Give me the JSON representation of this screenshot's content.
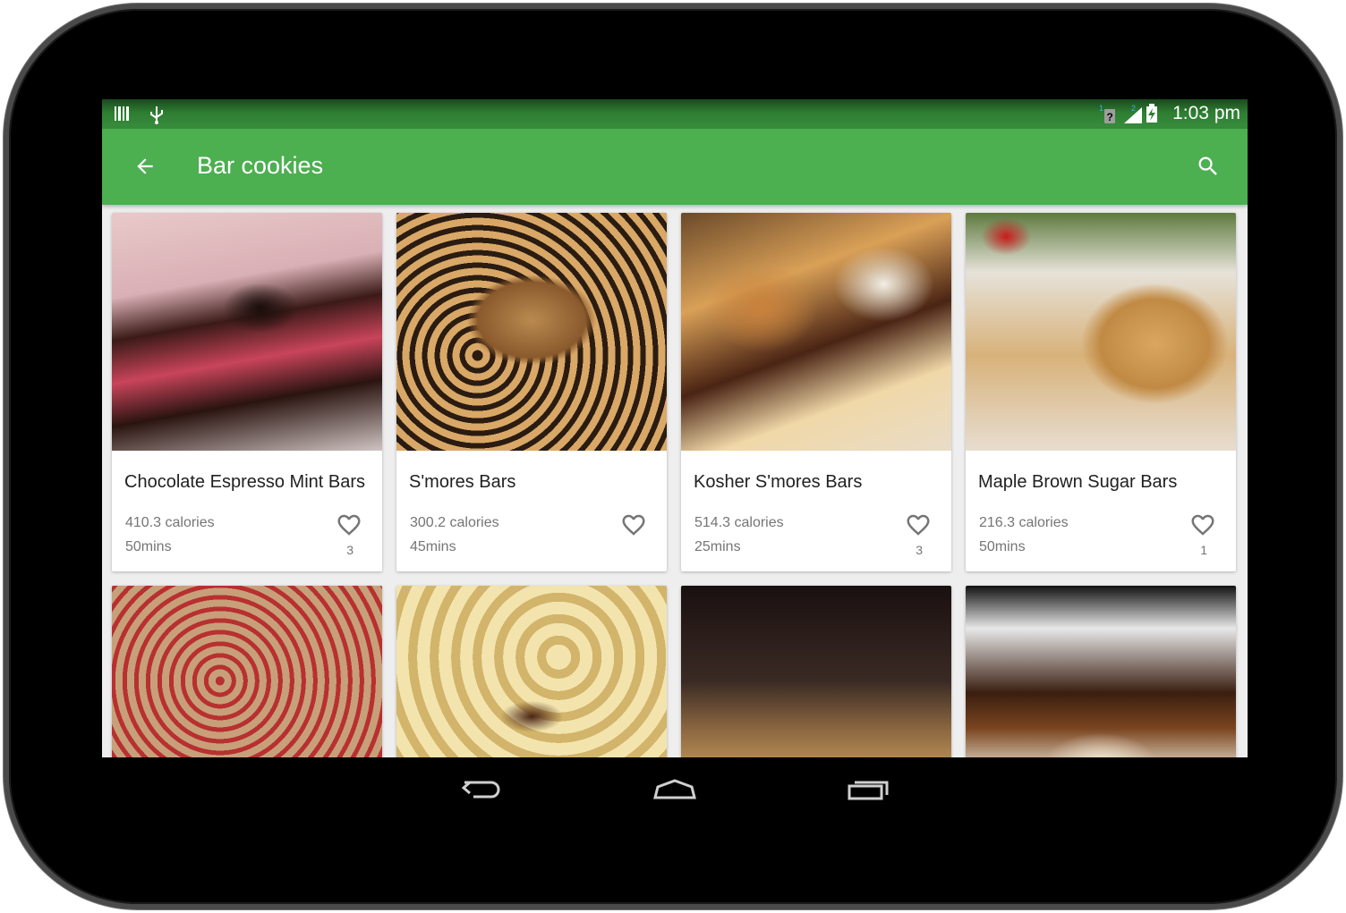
{
  "status_bar": {
    "time": "1:03 pm",
    "left_icons": [
      "barcode-icon",
      "usb-icon"
    ],
    "right_icons": [
      "sim-unknown-icon",
      "signal-icon",
      "battery-charging-icon"
    ]
  },
  "app_bar": {
    "title": "Bar cookies",
    "back_icon": "arrow-back-icon",
    "search_icon": "search-icon",
    "color": "#4caf50"
  },
  "recipes": [
    {
      "name": "Chocolate Espresso Mint Bars",
      "calories": "410.3 calories",
      "time": "50mins",
      "favorites": "3"
    },
    {
      "name": "S'mores Bars",
      "calories": "300.2 calories",
      "time": "45mins",
      "favorites": ""
    },
    {
      "name": "Kosher S'mores Bars",
      "calories": "514.3 calories",
      "time": "25mins",
      "favorites": "3"
    },
    {
      "name": "Maple Brown Sugar Bars",
      "calories": "216.3 calories",
      "time": "50mins",
      "favorites": "1"
    }
  ],
  "nav_bar": {
    "back_icon": "nav-back-icon",
    "home_icon": "nav-home-icon",
    "recents_icon": "nav-recents-icon"
  }
}
